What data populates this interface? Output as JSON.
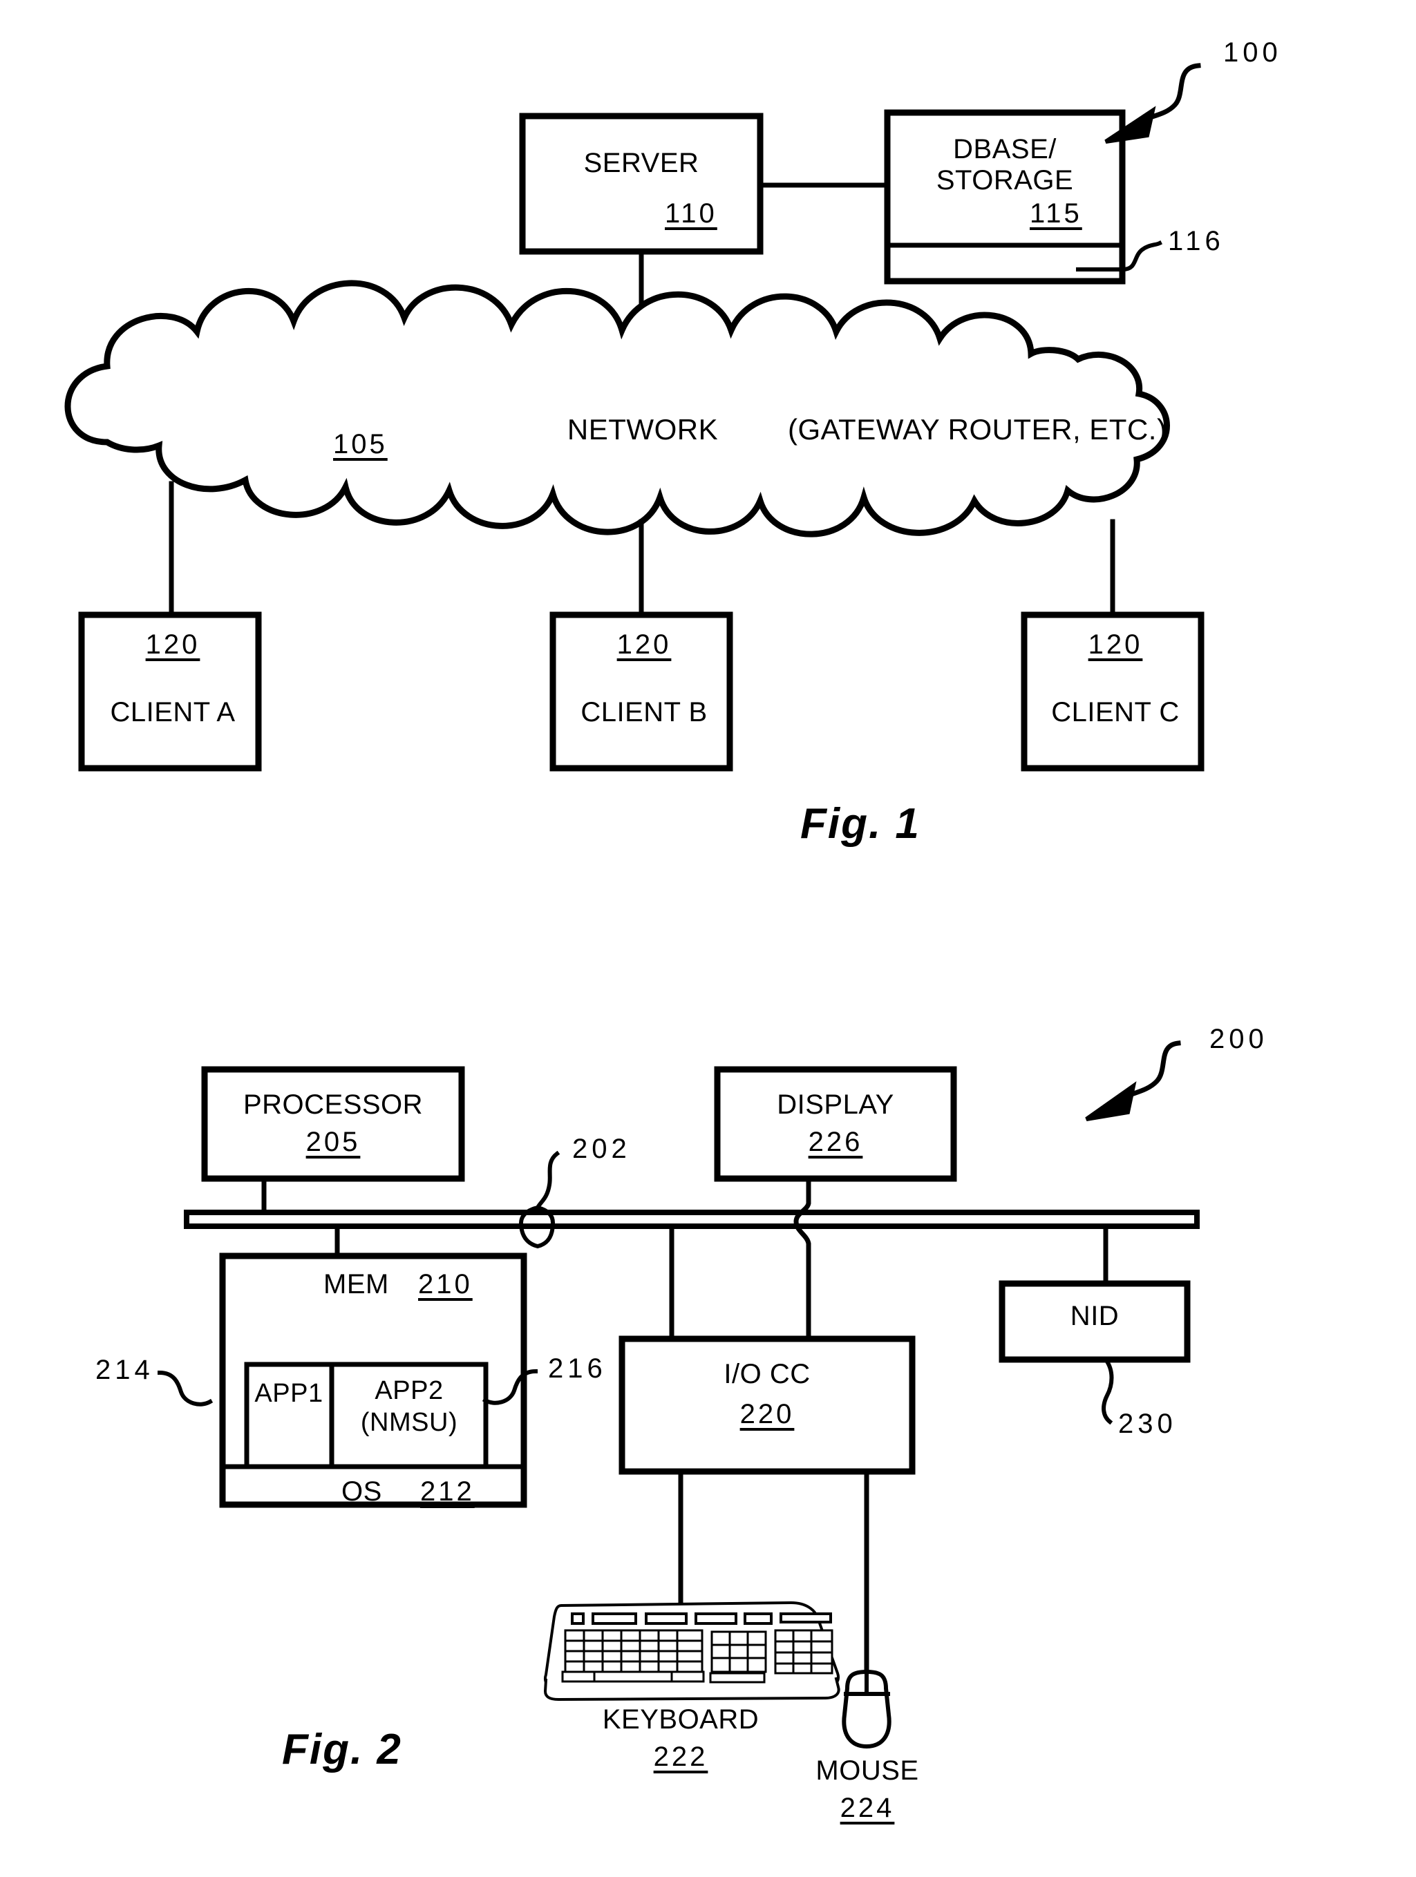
{
  "document": {
    "type": "patent-drawing-sheet",
    "figures": [
      "Fig. 1",
      "Fig. 2"
    ]
  },
  "figure1": {
    "caption": "Fig.  1",
    "system_ref": "100",
    "server": {
      "title": "SERVER",
      "ref": "110"
    },
    "dbase": {
      "title_line1": "DBASE/",
      "title_line2": "STORAGE",
      "ref": "115",
      "sub_ref": "116"
    },
    "network": {
      "label": "NETWORK",
      "note": "(GATEWAY ROUTER, ETC.)",
      "ref": "105"
    },
    "clients": [
      {
        "ref": "120",
        "label": "CLIENT A"
      },
      {
        "ref": "120",
        "label": "CLIENT B"
      },
      {
        "ref": "120",
        "label": "CLIENT C"
      }
    ]
  },
  "figure2": {
    "caption": "Fig.  2",
    "system_ref": "200",
    "bus_ref": "202",
    "processor": {
      "title": "PROCESSOR",
      "ref": "205"
    },
    "display": {
      "title": "DISPLAY",
      "ref": "226"
    },
    "memory": {
      "title": "MEM",
      "ref": "210"
    },
    "app1": {
      "label": "APP1",
      "ref": "214"
    },
    "app2": {
      "label_line1": "APP2",
      "label_line2": "(NMSU)",
      "ref": "216"
    },
    "os": {
      "title": "OS",
      "ref": "212"
    },
    "io_controller": {
      "title": "I/O CC",
      "ref": "220"
    },
    "nid": {
      "title": "NID",
      "ref": "230"
    },
    "keyboard": {
      "title": "KEYBOARD",
      "ref": "222"
    },
    "mouse": {
      "title": "MOUSE",
      "ref": "224"
    }
  }
}
